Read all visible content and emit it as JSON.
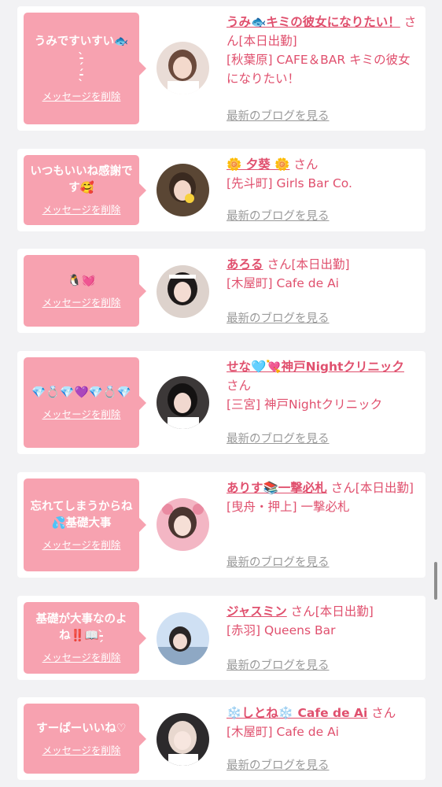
{
  "delete_label": "メッセージを削除",
  "blog_label": "最新のブログを見る",
  "san_label": "さん",
  "items": [
    {
      "message": "うみですいすい🐟\n-̗̀\n-̖́",
      "name": "うみ🐟キミの彼女になりたい！",
      "tag": "[本日出勤]",
      "shop": "[秋葉原] CAFE＆BAR キミの彼女になりたい！"
    },
    {
      "message": "いつもいいね感謝です🥰",
      "name": "🌼 夕葵 🌼",
      "tag": "",
      "shop": "[先斗町] Girls Bar Co."
    },
    {
      "message": "🐧💓",
      "name": "あろる",
      "tag": "[本日出勤]",
      "shop": "[木屋町] Cafe de Ai"
    },
    {
      "message": "💎💍💎💜💎💍💎",
      "name": "せな🩵💘神戸Nightクリニック",
      "tag": "",
      "shop": "[三宮] 神戸Nightクリニック"
    },
    {
      "message": "忘れてしまうからね💦基礎大事",
      "name": "ありす📚一撃必札",
      "tag": "[本日出勤]",
      "shop": "[曳舟・押上] 一撃必札"
    },
    {
      "message": "基礎が大事なのよね‼️📖-̗̀",
      "name": "ジャスミン",
      "tag": "[本日出勤]",
      "shop": "[赤羽] Queens Bar"
    },
    {
      "message": "すーぱーいいね♡",
      "name": "❄️しとね❄️ Cafe de Ai",
      "tag": "",
      "shop": "[木屋町] Cafe de Ai"
    }
  ]
}
